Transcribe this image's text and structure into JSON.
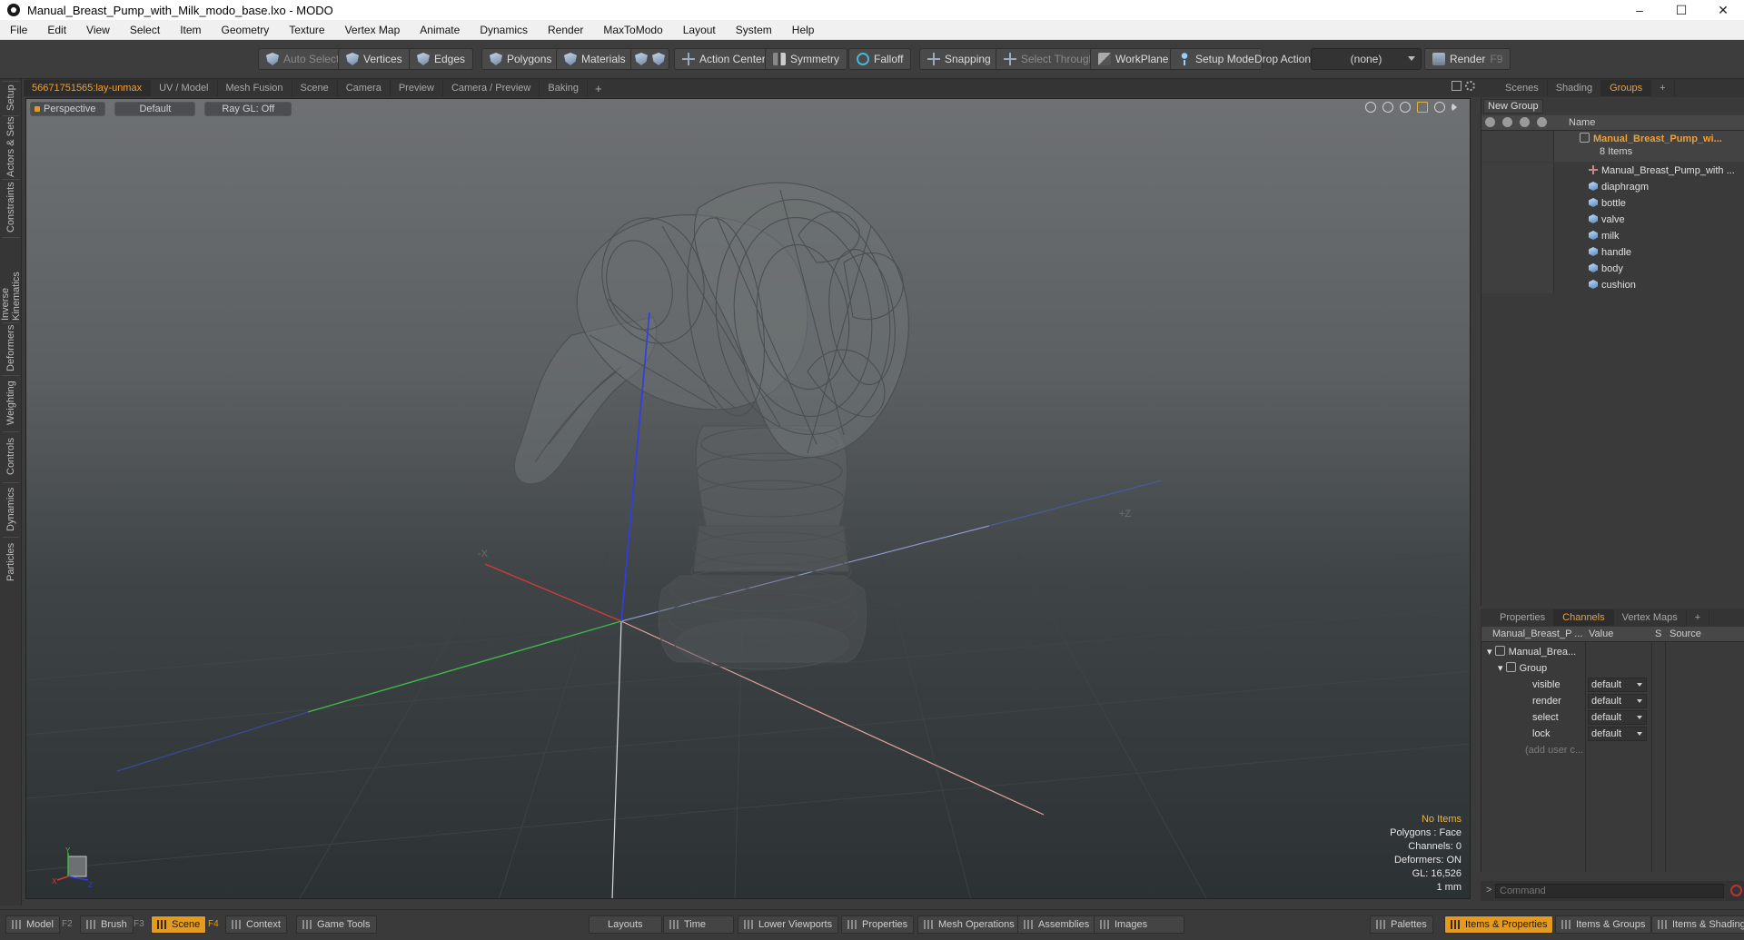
{
  "window": {
    "title": "Manual_Breast_Pump_with_Milk_modo_base.lxo - MODO",
    "controls": [
      "–",
      "☐",
      "✕"
    ]
  },
  "menu": [
    "File",
    "Edit",
    "View",
    "Select",
    "Item",
    "Geometry",
    "Texture",
    "Vertex Map",
    "Animate",
    "Dynamics",
    "Render",
    "MaxToModo",
    "Layout",
    "System",
    "Help"
  ],
  "toolbar": {
    "auto_select": "Auto Select",
    "vertices": "Vertices",
    "edges": "Edges",
    "polygons": "Polygons",
    "materials": "Materials",
    "action_center": "Action Center",
    "symmetry": "Symmetry",
    "falloff": "Falloff",
    "snapping": "Snapping",
    "select_through": "Select Through",
    "workplane": "WorkPlane",
    "setup_mode": "Setup Mode",
    "drop_action_label": "Drop Action",
    "drop_action_value": "(none)",
    "render": "Render",
    "render_key": "F9"
  },
  "left_tabs": [
    "Setup",
    "Actors & Sets",
    "Constraints",
    "Inverse Kinematics",
    "Deformers",
    "Weighting",
    "Controls",
    "Dynamics",
    "Particles"
  ],
  "viewport_tabs": {
    "active": "56671751565:lay-unmax",
    "others": [
      "UV / Model",
      "Mesh Fusion",
      "Scene",
      "Camera",
      "Preview",
      "Camera / Preview",
      "Baking"
    ],
    "add": "+"
  },
  "viewport": {
    "view_mode": "Perspective",
    "shading": "Default",
    "ray_gl": "Ray GL: Off",
    "label_neg_x": "-X",
    "label_pos_z": "+Z",
    "info": {
      "selection": "No Items",
      "polygons": "Polygons : Face",
      "channels": "Channels: 0",
      "deformers": "Deformers: ON",
      "gl": "GL: 16,526",
      "unit": "1 mm"
    },
    "gizmo": {
      "x": "X",
      "y": "Y",
      "z": "Z"
    }
  },
  "right_top_tabs": {
    "tabs": [
      "Scenes",
      "Shading",
      "Groups"
    ],
    "active": "Groups",
    "add": "+"
  },
  "groups": {
    "new_group": "New Group",
    "name_header": "Name",
    "group_name": "Manual_Breast_Pump_wi...",
    "group_count": "8 Items",
    "items": [
      "Manual_Breast_Pump_with ...",
      "diaphragm",
      "bottle",
      "valve",
      "milk",
      "handle",
      "body",
      "cushion"
    ]
  },
  "right_bottom_tabs": {
    "tabs": [
      "Properties",
      "Channels",
      "Vertex Maps"
    ],
    "active": "Channels",
    "add": "+"
  },
  "channels": {
    "headers": {
      "name": "Manual_Breast_P ...",
      "value": "Value",
      "s": "S",
      "source": "Source"
    },
    "root": "Manual_Brea...",
    "group": "Group",
    "rows": [
      {
        "name": "visible",
        "value": "default"
      },
      {
        "name": "render",
        "value": "default"
      },
      {
        "name": "select",
        "value": "default"
      },
      {
        "name": "lock",
        "value": "default"
      }
    ],
    "add_user": "(add user c..."
  },
  "command": {
    "prompt": ">",
    "placeholder": "Command"
  },
  "bottom_bar": {
    "model": "Model",
    "model_key": "F2",
    "brush": "Brush",
    "brush_key": "F3",
    "scene": "Scene",
    "scene_key": "F4",
    "context": "Context",
    "game_tools": "Game Tools",
    "layouts": "Layouts",
    "time": "Time",
    "lower_viewports": "Lower Viewports",
    "properties": "Properties",
    "mesh_operations": "Mesh Operations",
    "assemblies": "Assemblies",
    "images": "Images",
    "palettes": "Palettes",
    "items_properties": "Items & Properties",
    "items_groups": "Items & Groups",
    "items_shading": "Items & Shading"
  },
  "colors": {
    "accent": "#e49b1d",
    "viewport_top": "#6e7173",
    "viewport_bottom": "#2c3133",
    "x_axis": "#d23a3a",
    "y_axis": "#2f3fe0",
    "z_axis": "#3fb84a"
  }
}
